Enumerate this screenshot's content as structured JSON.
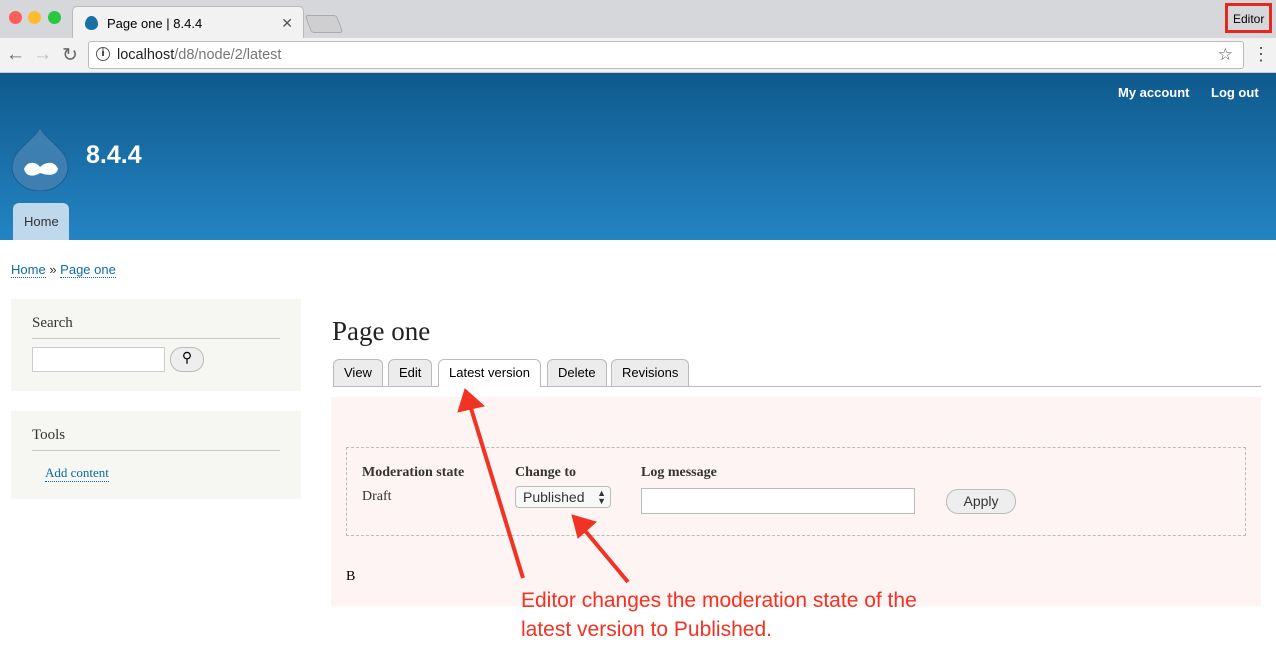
{
  "browser": {
    "tab_title": "Page one | 8.4.4",
    "url_host": "localhost",
    "url_path": "/d8/node/2/latest",
    "profile": "Editor"
  },
  "header": {
    "site_name": "8.4.4",
    "links": [
      "My account",
      "Log out"
    ],
    "nav": [
      "Home"
    ]
  },
  "breadcrumb": [
    "Home",
    "Page one"
  ],
  "breadcrumb_sep": "»",
  "sidebar": {
    "search_title": "Search",
    "tools_title": "Tools",
    "tools_items": [
      "Add content"
    ]
  },
  "page": {
    "title": "Page one",
    "tabs": [
      "View",
      "Edit",
      "Latest version",
      "Delete",
      "Revisions"
    ],
    "active_tab": "Latest version",
    "moderation": {
      "state_label": "Moderation state",
      "state_value": "Draft",
      "change_label": "Change to",
      "change_value": "Published",
      "log_label": "Log message",
      "log_value": "",
      "apply_label": "Apply"
    },
    "body": "B"
  },
  "annotation": {
    "line1": "Editor changes the moderation state of the",
    "line2": "latest version to Published.",
    "color": "#f03323"
  }
}
